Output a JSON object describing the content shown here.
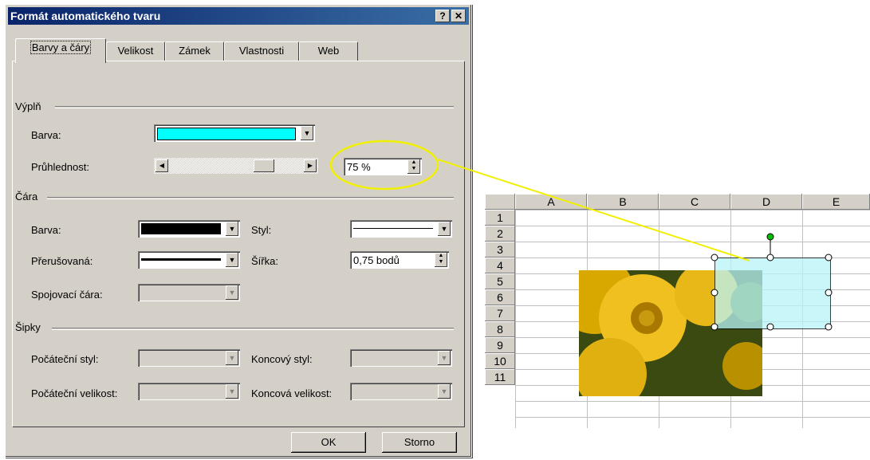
{
  "dialog": {
    "title": "Formát automatického tvaru",
    "help_label": "?",
    "close_label": "✕",
    "tabs": [
      "Barvy a čáry",
      "Velikost",
      "Zámek",
      "Vlastnosti",
      "Web"
    ],
    "fill": {
      "section": "Výplň",
      "color_label": "Barva:",
      "color_value": "#00ffff",
      "transparency_label": "Průhlednost:",
      "transparency_value": "75 %",
      "transparency_level": 0.75
    },
    "line": {
      "section": "Čára",
      "color_label": "Barva:",
      "color_value": "#000000",
      "style_label": "Styl:",
      "dashed_label": "Přerušovaná:",
      "weight_label": "Šířka:",
      "weight_value": "0,75 bodů",
      "connector_label": "Spojovací čára:"
    },
    "arrows": {
      "section": "Šipky",
      "begin_style_label": "Počáteční styl:",
      "end_style_label": "Koncový styl:",
      "begin_size_label": "Počáteční velikost:",
      "end_size_label": "Koncová velikost:"
    },
    "ok_label": "OK",
    "cancel_label": "Storno"
  },
  "sheet": {
    "columns": [
      "A",
      "B",
      "C",
      "D",
      "E"
    ],
    "rows": [
      "1",
      "2",
      "3",
      "4",
      "5",
      "6",
      "7",
      "8",
      "9",
      "10",
      "11"
    ],
    "shape_fill": "#b8f4f8",
    "highlight_color": "#f0f000"
  }
}
